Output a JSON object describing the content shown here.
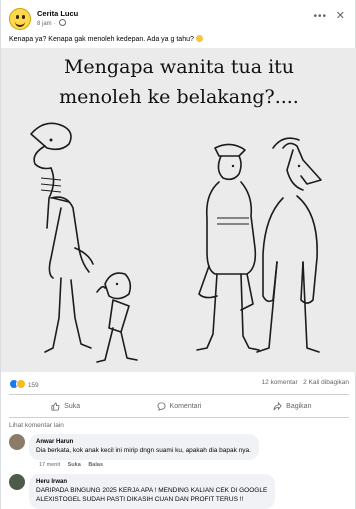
{
  "post": {
    "page_name": "Cerita Lucu",
    "time": "8 jam",
    "caption": "Kenapa ya? Kenapa gak menoleh kedepan. Ada ya g tahu?",
    "image_headline_line1": "Mengapa wanita tua itu",
    "image_headline_line2": "menoleh ke belakang?...."
  },
  "stats": {
    "reactions": "159",
    "comments": "12 komentar",
    "shares": "2 Kali dibagikan"
  },
  "actions": {
    "like": "Suka",
    "comment": "Komentari",
    "share": "Bagikan"
  },
  "more_comments": "Lihat komentar lain",
  "comments": [
    {
      "name": "Anwar Harun",
      "text": "Dia berkata, kok anak kecil ini mirip dngn suami ku, apakah dia bapak nya.",
      "time": "17 menit",
      "like": "Suka",
      "reply": "Balas"
    },
    {
      "name": "Heru Irwan",
      "text_line1": "DARIPADA BINGUNG 2025 KERJA APA ! MENDING KALIAN CEK DI GOOGLE",
      "text_line2": "ALEXISTOGEL SUDAH PASTI DIKASIH CUAN DAN PROFIT TERUS !!"
    }
  ],
  "colors": {
    "accent": "#1877f2",
    "secondary_text": "#65676b",
    "bubble": "#f0f2f5"
  }
}
